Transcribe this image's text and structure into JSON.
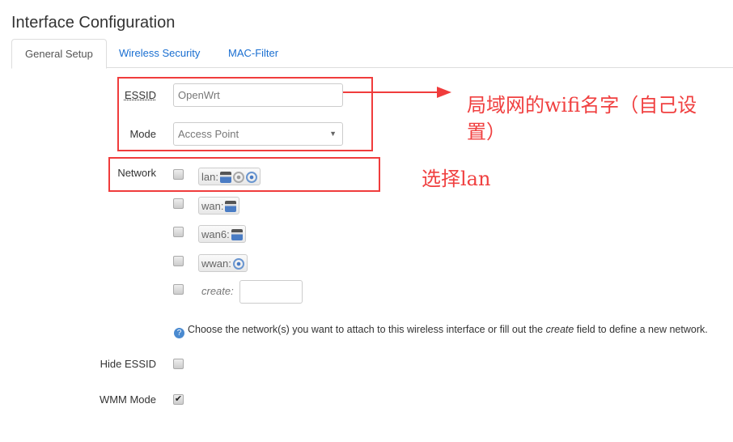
{
  "title": "Interface Configuration",
  "tabs": [
    {
      "label": "General Setup"
    },
    {
      "label": "Wireless Security"
    },
    {
      "label": "MAC-Filter"
    }
  ],
  "essid": {
    "label": "ESSID",
    "value": "OpenWrt"
  },
  "mode": {
    "label": "Mode",
    "value": "Access Point"
  },
  "network": {
    "label": "Network",
    "options": [
      {
        "label": "lan:",
        "checked": false,
        "icons": [
          "ethernet-icon",
          "wifi-off-icon",
          "wifi-icon"
        ]
      },
      {
        "label": "wan:",
        "checked": false,
        "icons": [
          "ethernet-icon"
        ]
      },
      {
        "label": "wan6:",
        "checked": false,
        "icons": [
          "ethernet-icon"
        ]
      },
      {
        "label": "wwan:",
        "checked": false,
        "icons": [
          "wifi-icon"
        ]
      }
    ],
    "create_label": "create:",
    "help_pre": "Choose the network(s) you want to attach to this wireless interface or fill out the ",
    "help_em": "create",
    "help_post": " field to define a new network."
  },
  "hide_essid": {
    "label": "Hide ESSID",
    "checked": false
  },
  "wmm": {
    "label": "WMM Mode",
    "checked": true
  },
  "annotations": {
    "essid_note_1": "局域网的wifi名字（自己设",
    "essid_note_2": "置）",
    "network_note": "选择lan"
  },
  "colors": {
    "annotation": "#f03c3c",
    "link": "#1a6fd1"
  }
}
